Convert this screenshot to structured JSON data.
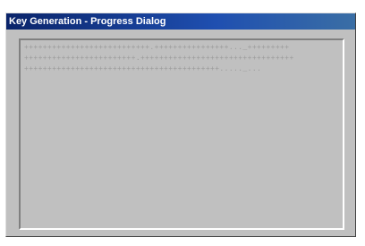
{
  "window": {
    "title": "Key Generation - Progress Dialog"
  },
  "progress": {
    "lines": [
      "+++++++++++++++++++++++++++.++++++++++++++++..._+++++++++",
      "++++++++++++++++++++++++.+++++++++++++++++++++++++++++++++",
      "++++++++++++++++++++++++++++++++++++++++++....._..."
    ]
  },
  "colors": {
    "titlebar": "#0a246a",
    "face": "#c0c0c0",
    "progress_text": "#9a9a9a"
  }
}
